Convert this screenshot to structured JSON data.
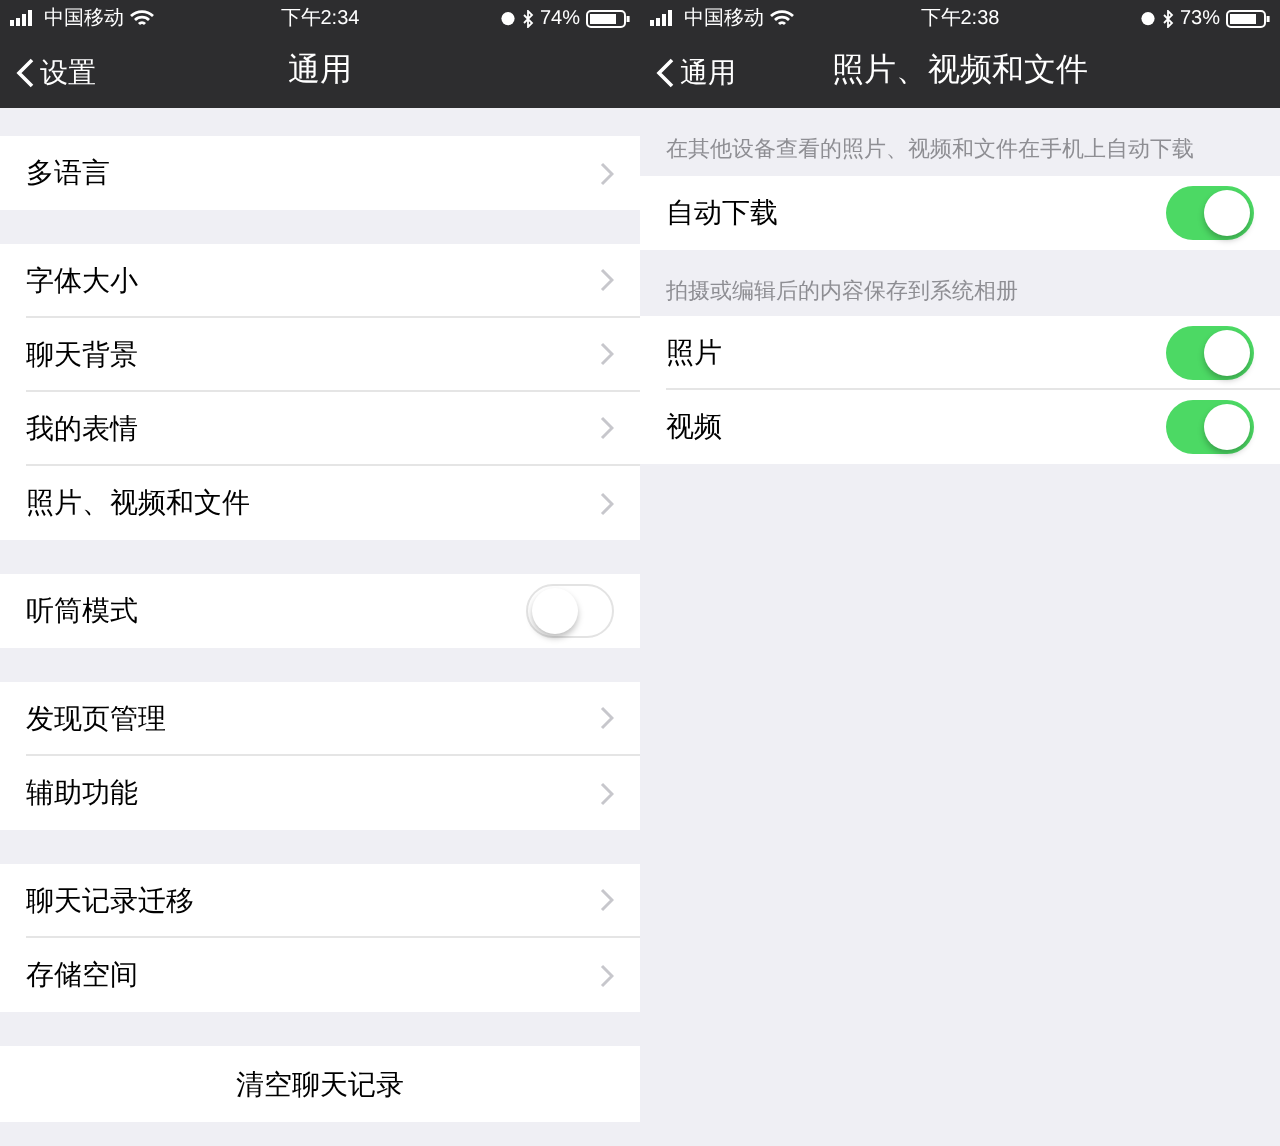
{
  "screens": [
    {
      "status": {
        "carrier": "中国移动",
        "time": "下午2:34",
        "battery": "74%"
      },
      "nav": {
        "back": "设置",
        "title": "通用"
      },
      "sections": [
        {
          "rows": [
            {
              "kind": "link",
              "label": "多语言"
            }
          ]
        },
        {
          "rows": [
            {
              "kind": "link",
              "label": "字体大小"
            },
            {
              "kind": "link",
              "label": "聊天背景"
            },
            {
              "kind": "link",
              "label": "我的表情"
            },
            {
              "kind": "link",
              "label": "照片、视频和文件"
            }
          ]
        },
        {
          "rows": [
            {
              "kind": "toggle",
              "label": "听筒模式",
              "on": false
            }
          ]
        },
        {
          "rows": [
            {
              "kind": "link",
              "label": "发现页管理"
            },
            {
              "kind": "link",
              "label": "辅助功能"
            }
          ]
        },
        {
          "rows": [
            {
              "kind": "link",
              "label": "聊天记录迁移"
            },
            {
              "kind": "link",
              "label": "存储空间"
            }
          ]
        },
        {
          "rows": [
            {
              "kind": "action",
              "label": "清空聊天记录"
            }
          ]
        }
      ]
    },
    {
      "status": {
        "carrier": "中国移动",
        "time": "下午2:38",
        "battery": "73%"
      },
      "nav": {
        "back": "通用",
        "title": "照片、视频和文件"
      },
      "sections": [
        {
          "header": "在其他设备查看的照片、视频和文件在手机上自动下载",
          "rows": [
            {
              "kind": "toggle",
              "label": "自动下载",
              "on": true
            }
          ]
        },
        {
          "header": "拍摄或编辑后的内容保存到系统相册",
          "rows": [
            {
              "kind": "toggle",
              "label": "照片",
              "on": true
            },
            {
              "kind": "toggle",
              "label": "视频",
              "on": true
            }
          ]
        }
      ]
    }
  ]
}
